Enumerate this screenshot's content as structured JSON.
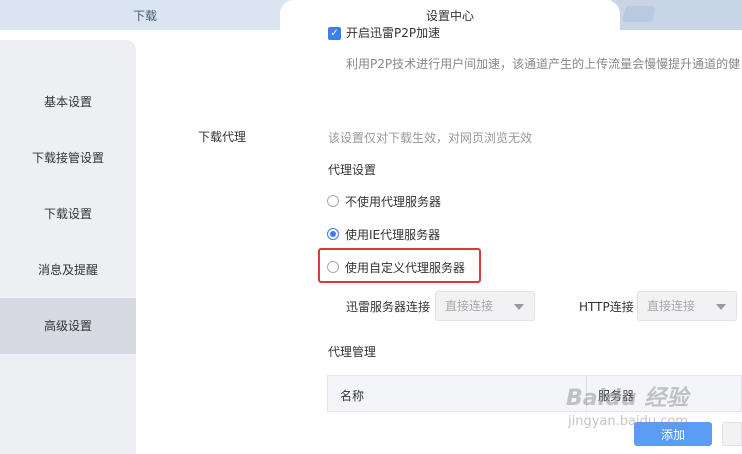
{
  "tabs": {
    "download_label": "下载",
    "active_label": "设置中心"
  },
  "sidebar": {
    "items": [
      {
        "label": "基本设置"
      },
      {
        "label": "下载接管设置"
      },
      {
        "label": "下载设置"
      },
      {
        "label": "消息及提醒"
      },
      {
        "label": "高级设置",
        "active": true
      }
    ]
  },
  "p2p": {
    "checked": true,
    "label": "开启迅雷P2P加速",
    "description": "利用P2P技术进行用户间加速，该通道产生的上传流量会慢慢提升通道的健"
  },
  "proxy": {
    "section_label": "下载代理",
    "note": "该设置仅对下载生效，对网页浏览无效",
    "settings_title": "代理设置",
    "options": [
      {
        "label": "不使用代理服务器",
        "checked": false
      },
      {
        "label": "使用IE代理服务器",
        "checked": true
      },
      {
        "label": "使用自定义代理服务器",
        "checked": false
      }
    ],
    "thunder_conn_label": "迅雷服务器连接",
    "thunder_conn_value": "直接连接",
    "http_conn_label": "HTTP连接",
    "http_conn_value": "直接连接"
  },
  "management": {
    "title": "代理管理",
    "columns": [
      "名称",
      "服务器"
    ],
    "add_button": "添加"
  },
  "watermark": {
    "logo": "Baidu 经验",
    "sub": "jingyan.baidu.com"
  },
  "colors": {
    "accent": "#3a7ef0",
    "highlight": "#d93a3a",
    "button": "#5b9cf6"
  }
}
